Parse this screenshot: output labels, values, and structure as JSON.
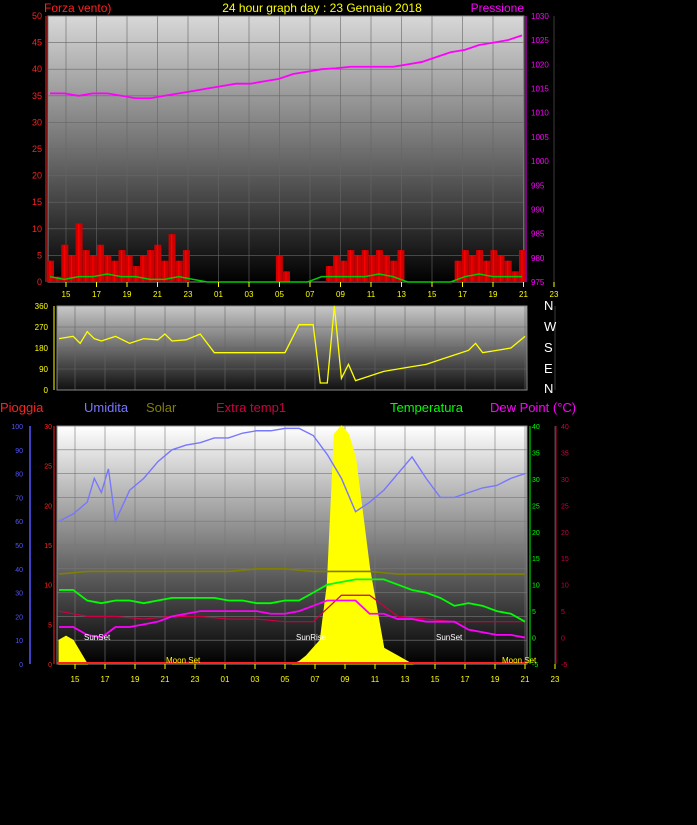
{
  "header": {
    "left_label": "Forza vento)",
    "title": "24 hour graph day : 23 Gennaio 2018",
    "right_label": "Pressione"
  },
  "colors": {
    "wind": "#ff0000",
    "gust_fill": "#cc0000",
    "wind_avg": "#00cc00",
    "pressure": "#ff00ff",
    "direction": "#ffff00",
    "humidity": "#7777ff",
    "solar": "#808000",
    "extra_temp": "#cc0044",
    "temperature": "#00ff00",
    "dew_point": "#ff00ff",
    "rain": "#5555ff",
    "sun_fill": "#ffff00",
    "tick_yellow": "#ffff00",
    "panel_top": "#ffffff",
    "panel_bottom": "#000000"
  },
  "time_ticks": [
    "15",
    "17",
    "19",
    "21",
    "23",
    "01",
    "03",
    "05",
    "07",
    "09",
    "11",
    "13",
    "15",
    "17",
    "19",
    "21",
    "23"
  ],
  "direction_letters": [
    "N",
    "W",
    "S",
    "E",
    "N"
  ],
  "bottom_legend": {
    "rain": "Pioggia",
    "humidity": "Umidita",
    "solar": "Solar",
    "extra_temp": "Extra temp1",
    "temperature": "Temperatura",
    "dew_point": "Dew Point (°C)"
  },
  "annotations": {
    "sunset1": "SunSet",
    "sunrise": "SunRise",
    "sunset2": "SunSet",
    "moonset1": "Moon Set",
    "moonset2": "Moon Set"
  },
  "chart_data": [
    {
      "id": "wind_pressure",
      "type": "line",
      "x_unit": "hours (relative index 0-33)",
      "x_ticks": [
        "15",
        "17",
        "19",
        "21",
        "23",
        "01",
        "03",
        "05",
        "07",
        "09",
        "11",
        "13",
        "15",
        "17",
        "19",
        "21",
        "23"
      ],
      "y_left": {
        "label": "Forza vento)",
        "range": [
          0,
          50
        ],
        "ticks": [
          0,
          5,
          10,
          15,
          20,
          25,
          30,
          35,
          40,
          45,
          50
        ]
      },
      "y_right": {
        "label": "Pressione",
        "range": [
          975,
          1030
        ],
        "ticks": [
          975,
          980,
          985,
          990,
          995,
          1000,
          1005,
          1010,
          1015,
          1020,
          1025,
          1030
        ]
      },
      "series": [
        {
          "name": "Pressione",
          "axis": "right",
          "x": [
            0,
            1,
            2,
            3,
            4,
            5,
            6,
            7,
            8,
            9,
            10,
            11,
            12,
            13,
            14,
            15,
            16,
            17,
            18,
            19,
            20,
            21,
            22,
            23,
            24,
            25,
            26,
            27,
            28,
            29,
            30,
            31,
            32,
            33
          ],
          "values": [
            1014,
            1014,
            1013.5,
            1014,
            1014,
            1013.5,
            1013,
            1013,
            1013.5,
            1014,
            1014.5,
            1015,
            1015.5,
            1016,
            1016,
            1016.5,
            1017,
            1018,
            1018.5,
            1019,
            1019.2,
            1019.5,
            1019.5,
            1019.5,
            1019.5,
            1020,
            1020.5,
            1021.5,
            1022.5,
            1023,
            1024,
            1024.5,
            1025,
            1026
          ]
        },
        {
          "name": "Gust",
          "axis": "left",
          "x": [
            0,
            0.5,
            1,
            1.5,
            2,
            2.5,
            3,
            3.5,
            4,
            4.5,
            5,
            5.5,
            6,
            6.5,
            7,
            7.5,
            8,
            8.5,
            9,
            9.5,
            10,
            10.5,
            11,
            11.5,
            12,
            12.5,
            13,
            13.5,
            14,
            14.5,
            15,
            15.5,
            16,
            16.5,
            17,
            17.5,
            18,
            18.5,
            19,
            19.5,
            20,
            20.5,
            21,
            21.5,
            22,
            22.5,
            23,
            23.5,
            24,
            24.5,
            25,
            25.5,
            26,
            26.5,
            27,
            27.5,
            28,
            28.5,
            29,
            29.5,
            30,
            30.5,
            31,
            31.5,
            32,
            32.5,
            33
          ],
          "values": [
            4,
            1,
            7,
            5,
            11,
            6,
            5,
            7,
            5,
            4,
            6,
            5,
            3,
            5,
            6,
            7,
            4,
            9,
            4,
            6,
            0,
            0,
            0,
            0,
            0,
            0,
            0,
            0,
            0,
            0,
            0,
            0,
            5,
            2,
            0,
            0,
            0,
            0,
            0,
            3,
            5,
            4,
            6,
            5,
            6,
            5,
            6,
            5,
            4,
            6,
            0,
            0,
            0,
            0,
            0,
            0,
            0,
            4,
            6,
            5,
            6,
            4,
            6,
            5,
            4,
            2,
            6
          ]
        },
        {
          "name": "Vento medio",
          "axis": "left",
          "x": [
            0,
            1,
            2,
            3,
            4,
            5,
            6,
            7,
            8,
            9,
            10,
            11,
            12,
            13,
            14,
            15,
            16,
            17,
            18,
            19,
            20,
            21,
            22,
            23,
            24,
            25,
            26,
            27,
            28,
            29,
            30,
            31,
            32,
            33
          ],
          "values": [
            1,
            0.5,
            1,
            1,
            1.5,
            1,
            1,
            0.5,
            0.5,
            1,
            0.5,
            0,
            0,
            0,
            0,
            0,
            0,
            0,
            0,
            1,
            1,
            1,
            1,
            1.5,
            1,
            0,
            0,
            0,
            0,
            1,
            1.5,
            1,
            1,
            1
          ]
        }
      ]
    },
    {
      "id": "wind_direction",
      "type": "line",
      "y_left": {
        "range": [
          0,
          360
        ],
        "ticks": [
          0,
          90,
          180,
          270,
          360
        ]
      },
      "series": [
        {
          "name": "Direzione",
          "x": [
            0,
            1,
            1.5,
            2,
            2.5,
            3,
            4,
            5,
            6,
            7,
            7.5,
            8,
            9,
            10,
            11,
            12,
            13,
            14,
            15,
            16,
            17,
            18,
            18.5,
            19,
            19.5,
            20,
            20.5,
            21,
            22,
            23,
            24,
            25,
            26,
            27,
            28,
            29,
            29.5,
            30,
            31,
            32,
            33
          ],
          "values": [
            220,
            230,
            200,
            250,
            220,
            210,
            230,
            200,
            220,
            215,
            240,
            210,
            215,
            240,
            160,
            160,
            160,
            160,
            160,
            160,
            280,
            280,
            30,
            30,
            360,
            50,
            110,
            40,
            60,
            80,
            90,
            100,
            110,
            130,
            150,
            170,
            200,
            160,
            170,
            180,
            230
          ]
        }
      ]
    },
    {
      "id": "humidity_temperature",
      "type": "line",
      "x_ticks": [
        "15",
        "17",
        "19",
        "21",
        "23",
        "01",
        "03",
        "05",
        "07",
        "09",
        "11",
        "13",
        "15",
        "17",
        "19",
        "21",
        "23"
      ],
      "y_left_humidity": {
        "label": "Umidita",
        "range": [
          0,
          100
        ],
        "ticks": [
          0,
          10,
          20,
          30,
          40,
          50,
          60,
          70,
          80,
          90,
          100
        ]
      },
      "y_left_rain": {
        "label": "Pioggia",
        "range": [
          0,
          30
        ],
        "ticks": [
          0,
          5,
          10,
          15,
          20,
          25,
          30
        ]
      },
      "y_right_temp": {
        "label": "Temperatura",
        "range": [
          -5,
          40
        ],
        "ticks": [
          -5,
          0,
          5,
          10,
          15,
          20,
          25,
          30,
          35,
          40
        ]
      },
      "y_right_dew": {
        "label": "Dew Point (°C)",
        "range": [
          -5,
          40
        ],
        "ticks": [
          -5,
          0,
          5,
          10,
          15,
          20,
          25,
          30,
          35,
          40
        ]
      },
      "series": [
        {
          "name": "Umidita",
          "axis": "humidity",
          "x": [
            0,
            1,
            2,
            2.5,
            3,
            3.5,
            4,
            5,
            6,
            7,
            8,
            9,
            10,
            11,
            12,
            13,
            14,
            15,
            16,
            17,
            18,
            19,
            20,
            21,
            22,
            23,
            24,
            25,
            26,
            27,
            28,
            29,
            30,
            31,
            32,
            33
          ],
          "values": [
            60,
            63,
            68,
            78,
            72,
            82,
            60,
            73,
            78,
            85,
            90,
            92,
            93,
            95,
            95,
            97,
            98,
            98,
            99,
            99,
            96,
            88,
            78,
            64,
            68,
            73,
            80,
            87,
            78,
            70,
            70,
            72,
            74,
            75,
            78,
            80
          ]
        },
        {
          "name": "Solar",
          "axis": "temp",
          "x": [
            0,
            2,
            4,
            6,
            8,
            10,
            12,
            14,
            16,
            18,
            20,
            22,
            24,
            26,
            28,
            30,
            33
          ],
          "values": [
            12,
            12.5,
            12.5,
            12.5,
            12.5,
            12.5,
            12.5,
            13,
            13,
            12.5,
            12.5,
            12.5,
            12,
            12,
            12,
            12,
            12
          ]
        },
        {
          "name": "Temperatura",
          "axis": "temp",
          "x": [
            0,
            1,
            2,
            3,
            4,
            5,
            6,
            7,
            8,
            9,
            10,
            11,
            12,
            13,
            14,
            15,
            16,
            17,
            18,
            19,
            20,
            21,
            22,
            23,
            24,
            25,
            26,
            27,
            28,
            29,
            30,
            31,
            32,
            33
          ],
          "values": [
            9,
            9,
            7,
            6.5,
            7,
            7,
            6.5,
            7,
            7.5,
            7.5,
            7.5,
            7.5,
            7,
            7,
            6.5,
            6.5,
            7,
            7,
            8.5,
            10,
            10.5,
            11,
            11,
            11,
            10,
            9,
            8.5,
            7.5,
            6,
            6.5,
            6,
            5,
            4.5,
            3
          ]
        },
        {
          "name": "Dew Point",
          "axis": "temp",
          "x": [
            0,
            1,
            2,
            3,
            4,
            5,
            6,
            7,
            8,
            9,
            10,
            11,
            12,
            13,
            14,
            15,
            16,
            17,
            18,
            19,
            20,
            21,
            22,
            23,
            24,
            25,
            26,
            27,
            28,
            29,
            30,
            31,
            32,
            33
          ],
          "values": [
            2,
            2,
            0.5,
            0,
            2,
            2,
            2.5,
            3,
            4,
            4.5,
            5,
            5,
            5,
            5,
            5,
            4.5,
            4.5,
            5,
            6,
            7,
            7,
            7,
            4.5,
            4.5,
            3.5,
            3.5,
            3,
            3,
            3,
            1.5,
            1,
            0.5,
            0.5,
            0
          ]
        },
        {
          "name": "Extra temp1",
          "axis": "temp",
          "x": [
            0,
            2,
            4,
            6,
            8,
            10,
            12,
            14,
            16,
            18,
            20,
            22,
            24,
            26,
            28,
            30,
            33
          ],
          "values": [
            5,
            4,
            4,
            3.5,
            4,
            4,
            3.5,
            3.5,
            3,
            3,
            8,
            8,
            4,
            3.5,
            3,
            3,
            3
          ]
        },
        {
          "name": "Solar radiation",
          "axis": "rain",
          "x": [
            0,
            0.5,
            1,
            1.5,
            2,
            16.5,
            17,
            17.5,
            18,
            18.5,
            19,
            19.5,
            20,
            20.5,
            21,
            22,
            23,
            24,
            24.5,
            25
          ],
          "values": [
            3,
            3.5,
            3,
            1.5,
            0,
            0,
            0.3,
            1,
            2,
            3,
            10,
            29,
            30,
            29,
            26,
            12,
            2,
            1,
            0.5,
            0
          ]
        }
      ]
    }
  ]
}
